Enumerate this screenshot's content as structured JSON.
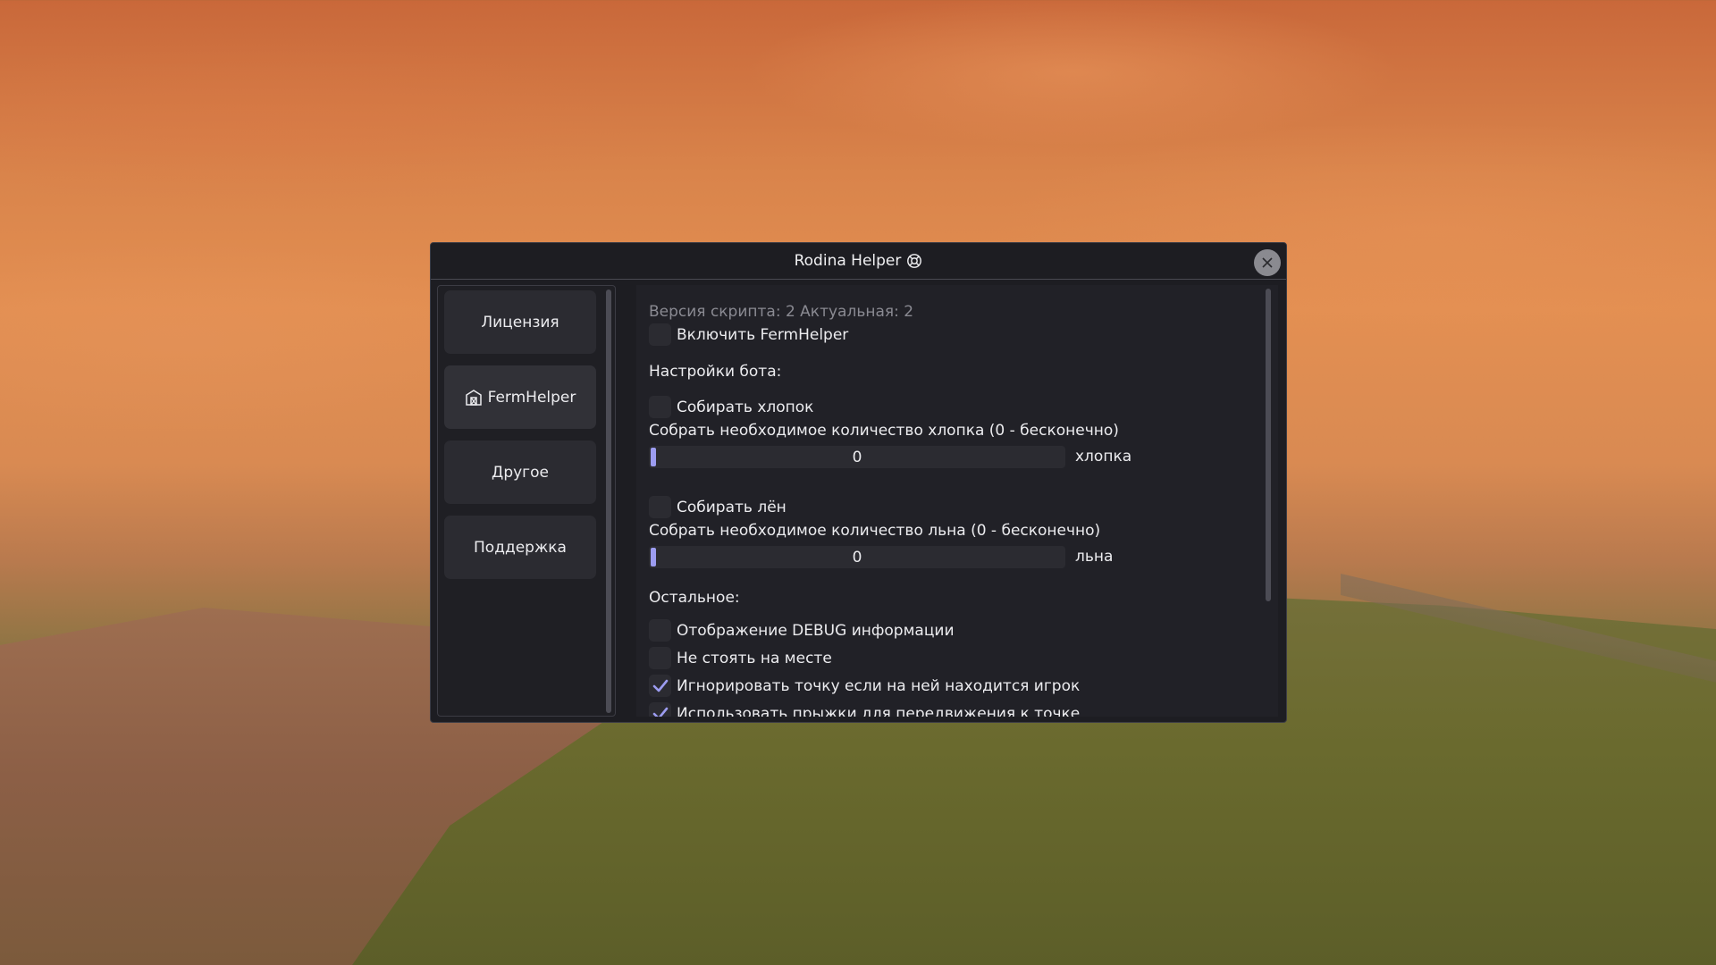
{
  "window": {
    "title": "Rodina Helper",
    "title_icon": "lifebuoy-icon"
  },
  "sidebar": {
    "items": [
      {
        "label": "Лицензия"
      },
      {
        "label": "FermHelper",
        "icon": "farm-icon",
        "active": true
      },
      {
        "label": "Другое"
      },
      {
        "label": "Поддержка"
      }
    ]
  },
  "content": {
    "version_text": "Версия скрипта: 2 Актуальная: 2",
    "enable_label": "Включить FermHelper",
    "bot_settings_heading": "Настройки бота:",
    "cotton": {
      "checkbox_label": "Собирать хлопок",
      "amount_label": "Собрать необходимое количество хлопка (0 - бесконечно)",
      "value": "0",
      "unit": "хлопка"
    },
    "flax": {
      "checkbox_label": "Собирать лён",
      "amount_label": "Собрать необходимое количество льна (0 - бесконечно)",
      "value": "0",
      "unit": "льна"
    },
    "other_heading": "Остальное:",
    "other_options": [
      {
        "label": "Отображение DEBUG информации",
        "checked": false
      },
      {
        "label": "Не стоять на месте",
        "checked": false
      },
      {
        "label": "Игнорировать точку если на ней находится игрок",
        "checked": true
      },
      {
        "label": "Использовать прыжки для передвижения к точке",
        "checked": true
      }
    ]
  },
  "colors": {
    "window_bg": "#1d1d22",
    "button_bg": "#2b2b31",
    "accent": "#9c9cf0",
    "text": "#ececef",
    "muted_text": "#8a8a92"
  }
}
